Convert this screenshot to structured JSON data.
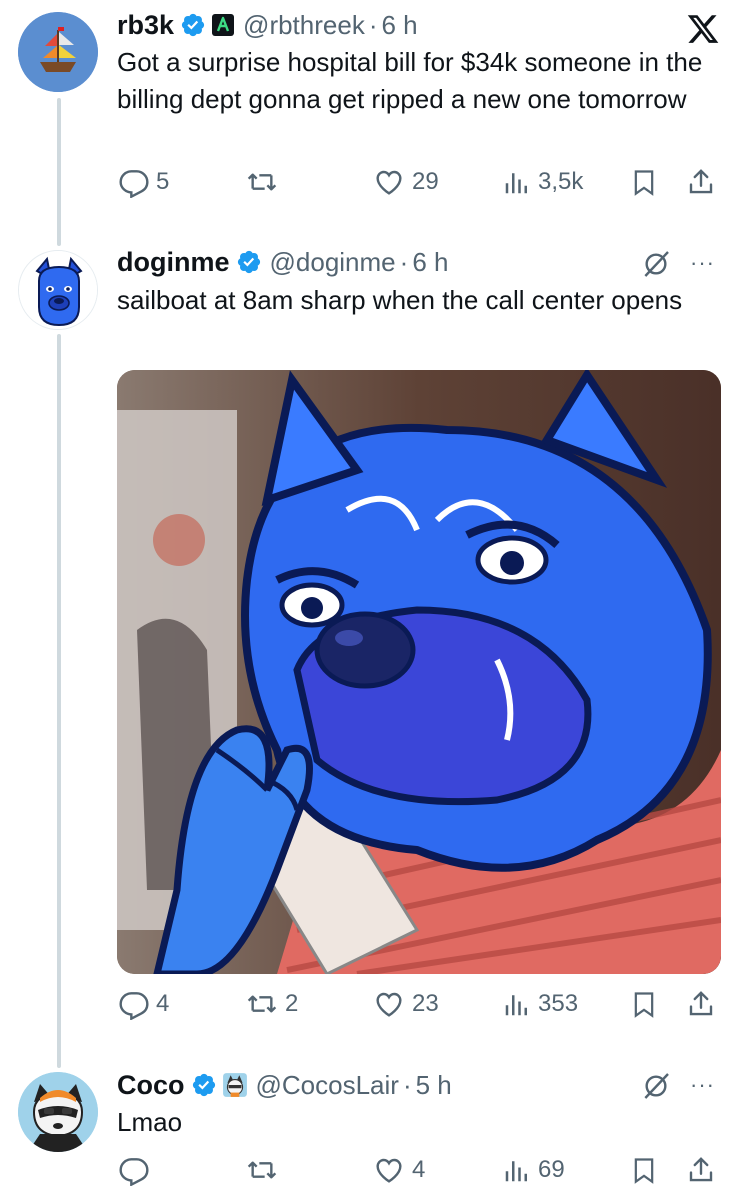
{
  "tweets": [
    {
      "name": "rb3k",
      "handle": "@rbthreek",
      "sep": "·",
      "time": "6 h",
      "text": "Got a surprise hospital bill for $34k someone in the billing dept gonna get ripped a new one tomorrow",
      "replies": "5",
      "retweets": "",
      "likes": "29",
      "views": "3,5k",
      "top_right_icon": "x-logo-icon",
      "avatar_icon": "sailboat-emoji-avatar"
    },
    {
      "name": "doginme",
      "handle": "@doginme",
      "sep": "·",
      "time": "6 h",
      "text": "sailboat at 8am sharp when the call center opens",
      "replies": "4",
      "retweets": "2",
      "likes": "23",
      "views": "353",
      "top_right_icon": "grok-icon",
      "avatar_icon": "blue-dog-avatar",
      "media": "blue-cartoon-dog-on-phone-image"
    },
    {
      "name": "Coco",
      "handle": "@CocosLair",
      "sep": "·",
      "time": "5 h",
      "text": "Lmao",
      "replies": "",
      "retweets": "",
      "likes": "4",
      "views": "69",
      "top_right_icon": "grok-icon",
      "avatar_icon": "raccoon-avatar"
    }
  ],
  "more_glyph": "···",
  "colors": {
    "verified": "#1d9bf0",
    "muted": "#536471",
    "text": "#0f1419",
    "thread_line": "#cfd9de"
  }
}
